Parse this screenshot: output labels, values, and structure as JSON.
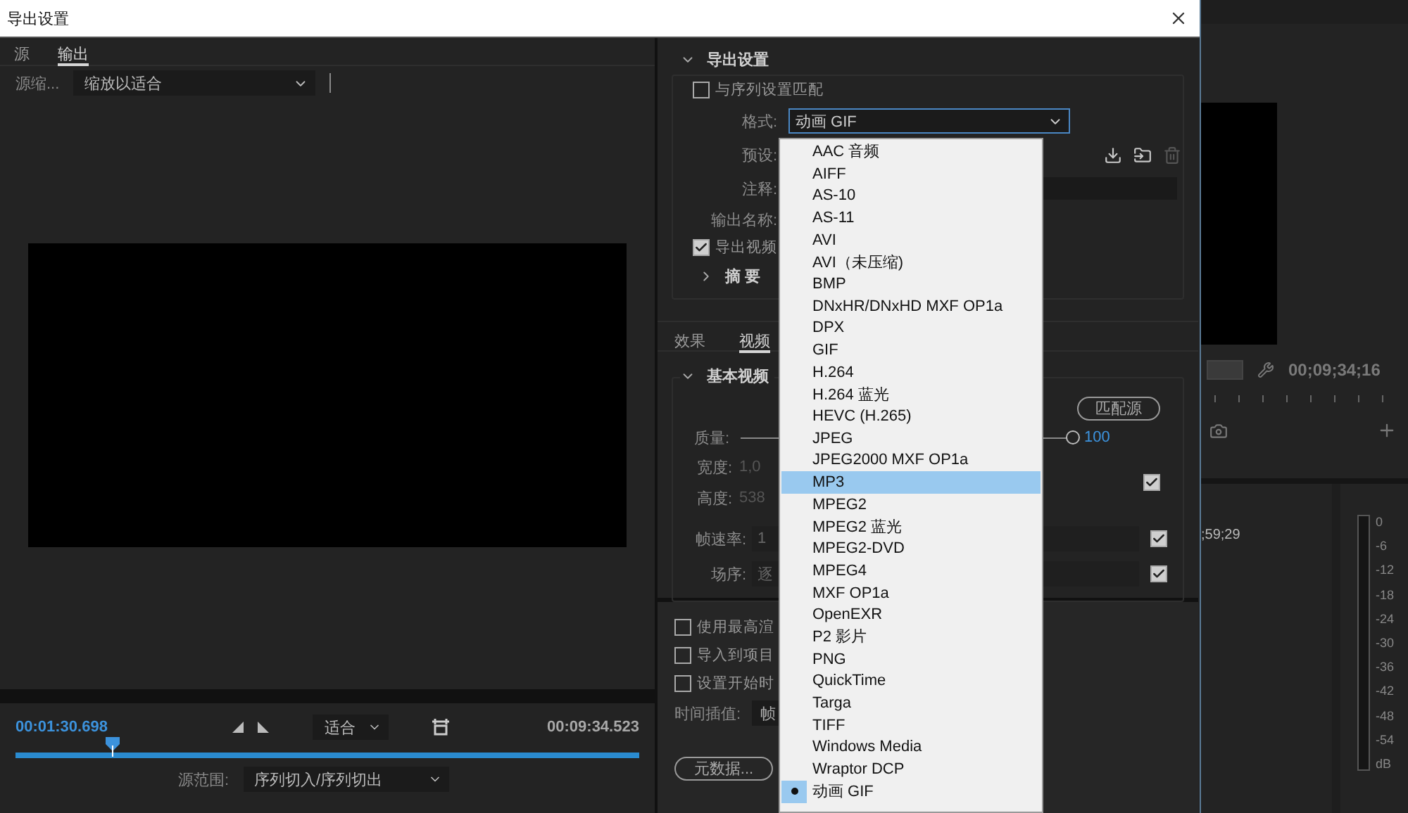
{
  "window": {
    "title": "导出设置"
  },
  "left": {
    "tabs": [
      {
        "label": "源",
        "selected": false
      },
      {
        "label": "输出",
        "selected": true
      }
    ],
    "scale_label": "源缩...",
    "scale_value": "缩放以适合",
    "current_time": "00:01:30.698",
    "fit_value": "适合",
    "duration": "00:09:34.523",
    "playhead": {
      "level": 0.16
    },
    "range_label": "源范围:",
    "range_value": "序列切入/序列切出"
  },
  "export_settings": {
    "title": "导出设置",
    "match_sequence": {
      "label": "与序列设置匹配",
      "checked": false
    },
    "format_label": "格式:",
    "format_value": "动画 GIF",
    "preset_label": "预设:",
    "comment_label": "注释:",
    "output_name_label": "输出名称:",
    "export_video": {
      "label": "导出视频",
      "checked": true
    },
    "summary": "摘 要"
  },
  "tabs": [
    {
      "label": "效果",
      "selected": false
    },
    {
      "label": "视频",
      "selected": true
    }
  ],
  "video": {
    "title": "基本视频",
    "match_source": "匹配源",
    "quality_label": "质量:",
    "quality": {
      "level": 1
    },
    "quality_value": "100",
    "width_label": "宽度:",
    "width_value": "1,0",
    "height_label": "高度:",
    "height_value": "538",
    "link_checked": true,
    "frame_rate_label": "帧速率:",
    "frame_rate_value": "1",
    "frame_rate_checked": true,
    "field_order_label": "场序:",
    "field_order_value": "逐",
    "field_order_checked": true
  },
  "options": [
    {
      "label": "使用最高渲",
      "checked": false
    },
    {
      "label": "导入到项目",
      "checked": false
    },
    {
      "label": "设置开始时",
      "checked": false
    }
  ],
  "interp_label": "时间插值:",
  "interp_value": "帧",
  "metadata_button": "元数据...",
  "format_menu": [
    {
      "label": "AAC 音频",
      "selected": false,
      "checked": false
    },
    {
      "label": "AIFF",
      "selected": false,
      "checked": false
    },
    {
      "label": "AS-10",
      "selected": false,
      "checked": false
    },
    {
      "label": "AS-11",
      "selected": false,
      "checked": false
    },
    {
      "label": "AVI",
      "selected": false,
      "checked": false
    },
    {
      "label": "AVI（未压缩)",
      "selected": false,
      "checked": false
    },
    {
      "label": "BMP",
      "selected": false,
      "checked": false
    },
    {
      "label": "DNxHR/DNxHD MXF OP1a",
      "selected": false,
      "checked": false
    },
    {
      "label": "DPX",
      "selected": false,
      "checked": false
    },
    {
      "label": "GIF",
      "selected": false,
      "checked": false
    },
    {
      "label": "H.264",
      "selected": false,
      "checked": false
    },
    {
      "label": "H.264 蓝光",
      "selected": false,
      "checked": false
    },
    {
      "label": "HEVC (H.265)",
      "selected": false,
      "checked": false
    },
    {
      "label": "JPEG",
      "selected": false,
      "checked": false
    },
    {
      "label": "JPEG2000 MXF OP1a",
      "selected": false,
      "checked": false
    },
    {
      "label": "MP3",
      "selected": true,
      "checked": false
    },
    {
      "label": "MPEG2",
      "selected": false,
      "checked": false
    },
    {
      "label": "MPEG2 蓝光",
      "selected": false,
      "checked": false
    },
    {
      "label": "MPEG2-DVD",
      "selected": false,
      "checked": false
    },
    {
      "label": "MPEG4",
      "selected": false,
      "checked": false
    },
    {
      "label": "MXF OP1a",
      "selected": false,
      "checked": false
    },
    {
      "label": "OpenEXR",
      "selected": false,
      "checked": false
    },
    {
      "label": "P2 影片",
      "selected": false,
      "checked": false
    },
    {
      "label": "PNG",
      "selected": false,
      "checked": false
    },
    {
      "label": "QuickTime",
      "selected": false,
      "checked": false
    },
    {
      "label": "Targa",
      "selected": false,
      "checked": false
    },
    {
      "label": "TIFF",
      "selected": false,
      "checked": false
    },
    {
      "label": "Windows Media",
      "selected": false,
      "checked": false
    },
    {
      "label": "Wraptor DCP",
      "selected": false,
      "checked": false
    },
    {
      "label": "动画 GIF",
      "selected": false,
      "checked": true
    }
  ],
  "background_app": {
    "timecode": "00;09;34;16",
    "timecode_partial": ";59;29",
    "meter_scale": [
      "0",
      "-6",
      "-12",
      "-18",
      "-24",
      "-30",
      "-36",
      "-42",
      "-48",
      "-54",
      "dB"
    ]
  }
}
